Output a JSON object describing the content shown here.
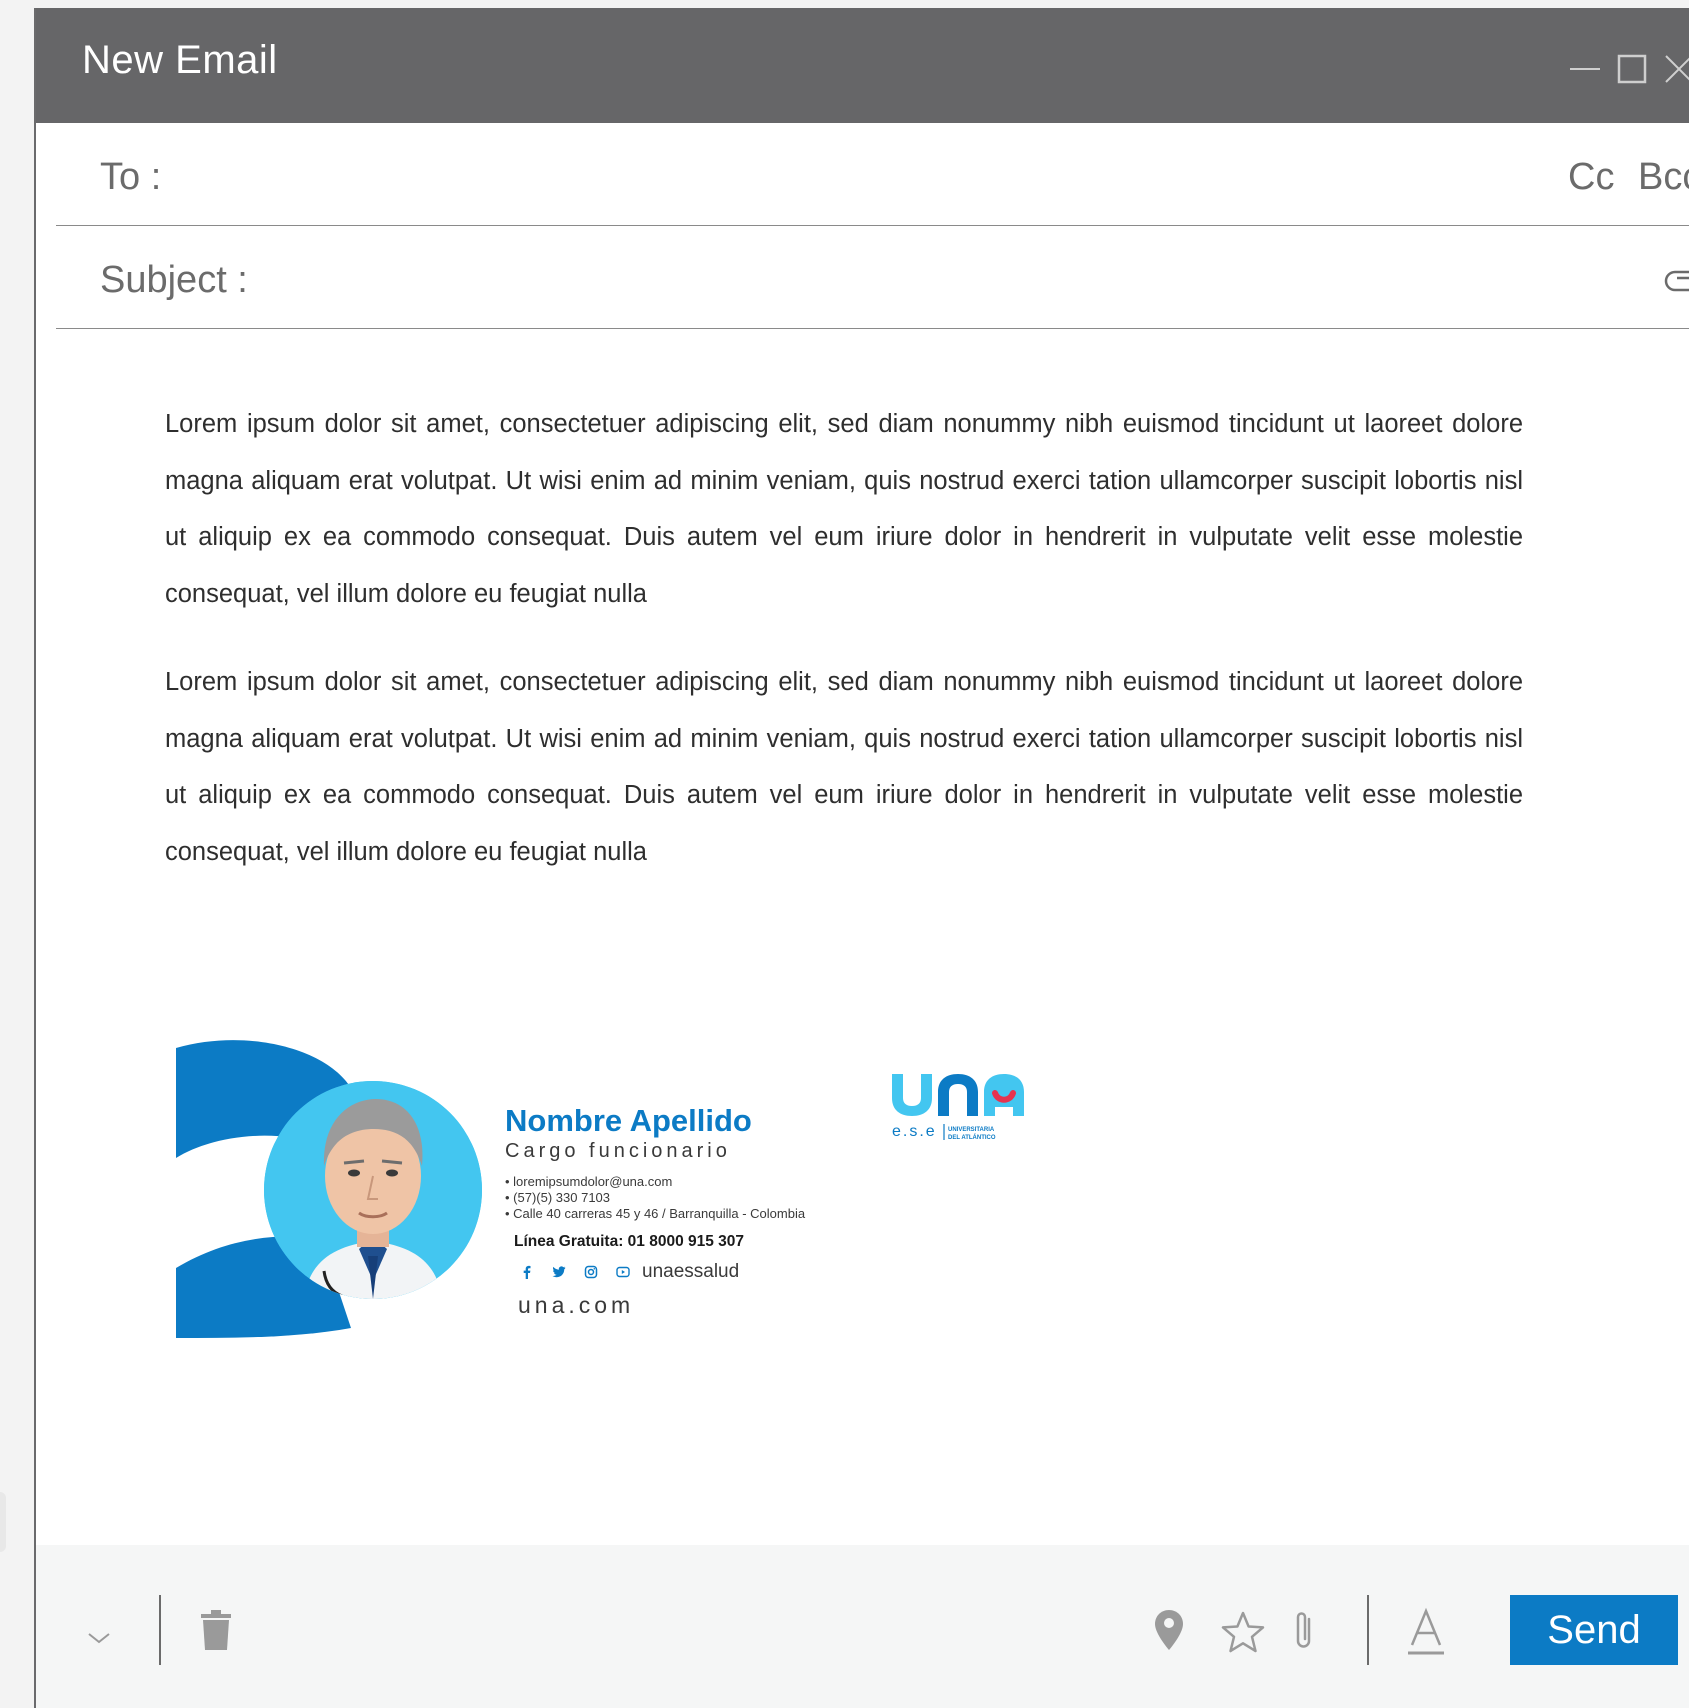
{
  "window": {
    "title": "New Email",
    "controls": [
      "minimize-icon",
      "maximize-icon",
      "close-icon"
    ]
  },
  "fields": {
    "to_label": "To :",
    "to_value": "",
    "cc_label": "Cc",
    "bcc_label": "Bcc",
    "subject_label": "Subject :",
    "subject_value": ""
  },
  "body": {
    "paragraphs": [
      "Lorem ipsum dolor sit amet, consectetuer adipiscing elit, sed diam nonummy nibh euismod tincidunt ut laoreet dolore magna aliquam erat volutpat. Ut wisi enim ad minim veniam, quis nostrud exerci tation ullamcorper suscipit lobortis nisl ut aliquip ex ea commodo consequat. Duis autem vel eum iriure dolor in hendrerit in vulputate velit esse molestie consequat, vel illum dolore eu feugiat nulla",
      "Lorem ipsum dolor sit amet, consectetuer adipiscing elit, sed diam nonummy nibh euismod tincidunt ut laoreet dolore magna aliquam erat volutpat. Ut wisi enim ad minim veniam, quis nostrud exerci tation ullamcorper suscipit lobortis nisl ut aliquip ex ea commodo consequat. Duis autem vel eum iriure dolor in hendrerit in vulputate velit esse molestie consequat, vel illum dolore eu feugiat nulla"
    ]
  },
  "signature": {
    "name": "Nombre Apellido",
    "role": "Cargo funcionario",
    "email_line": "• loremipsumdolor@una.com",
    "phone_line": "• (57)(5) 330 7103",
    "address_line": "• Calle 40 carreras 45 y 46 / Barranquilla - Colombia",
    "hotline": "Línea Gratuita: 01 8000 915 307",
    "social_icons": [
      "facebook-icon",
      "twitter-icon",
      "instagram-icon",
      "youtube-icon"
    ],
    "social_handle": "unaessalud",
    "website": "una.com",
    "logo": {
      "wordmark": "una",
      "subtext": "e.s.e",
      "tagline_1": "UNIVERSITARIA",
      "tagline_2": "DEL ATLÁNTICO"
    },
    "colors": {
      "brand_blue": "#0c7bc5",
      "light_blue": "#43c6f0",
      "accent_red": "#e6334f"
    }
  },
  "toolbar": {
    "send_label": "Send",
    "icons": [
      "chevron-down-icon",
      "trash-icon",
      "location-pin-icon",
      "star-icon",
      "attach-icon",
      "font-color-icon"
    ],
    "send_color": "#0c7bc5"
  },
  "colors": {
    "titlebar": "#666668",
    "toolbar_bg": "#f5f6f6",
    "text": "#2e2e2e"
  }
}
